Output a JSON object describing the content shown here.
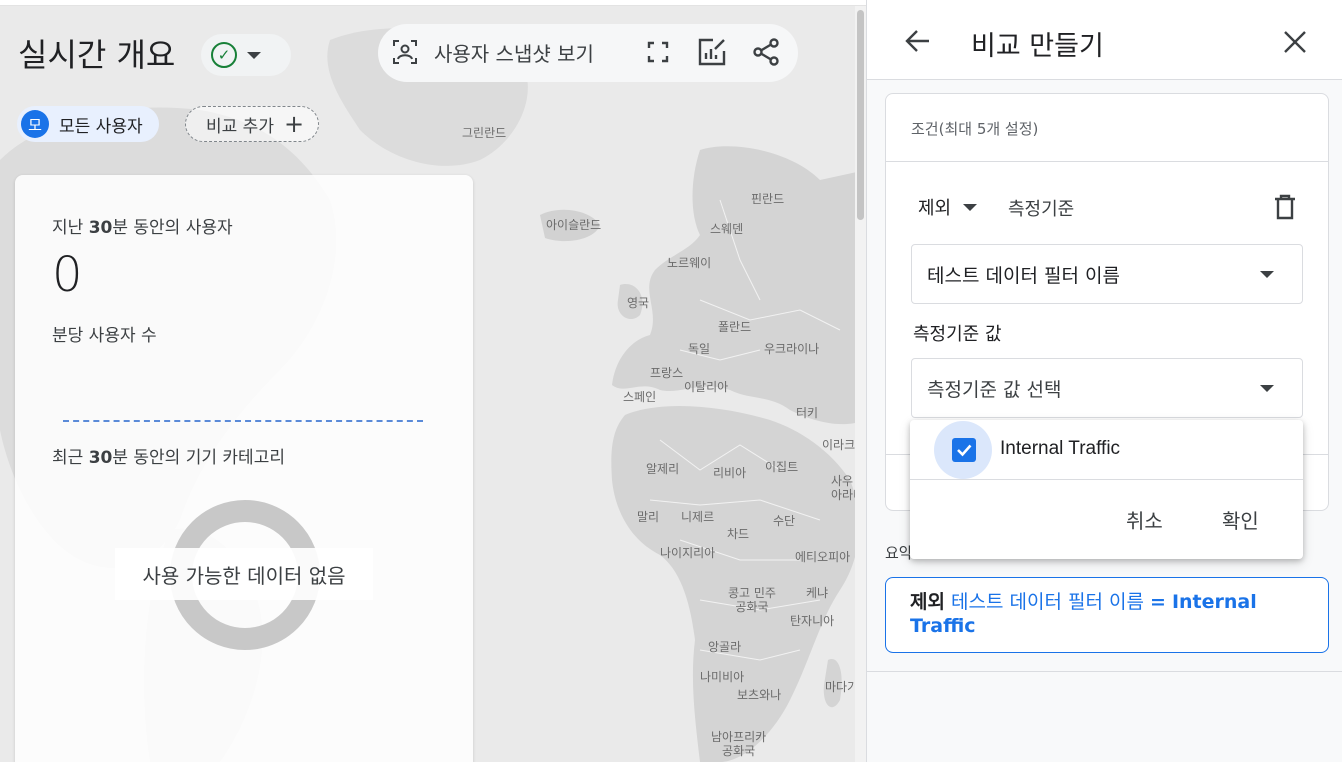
{
  "header": {
    "title": "실시간 개요",
    "status_icon": "check-circle-icon",
    "toolbar": {
      "snapshot_label": "사용자 스냅샷 보기",
      "icons": [
        "user-snapshot-icon",
        "fullscreen-icon",
        "customize-report-icon",
        "share-icon"
      ]
    }
  },
  "comparisons": {
    "all_users_avatar": "모",
    "all_users_label": "모든 사용자",
    "add_label": "비교 추가"
  },
  "map": {
    "labels": [
      "그린란드",
      "아이슬란드",
      "핀란드",
      "스웨덴",
      "노르웨이",
      "영국",
      "폴란드",
      "독일",
      "우크라이나",
      "프랑스",
      "이탈리아",
      "스페인",
      "터키",
      "이라크",
      "알제리",
      "리비아",
      "이집트",
      "사우디아라비아",
      "말리",
      "니제르",
      "차드",
      "수단",
      "나이지리아",
      "에티오피아",
      "콩고 민주 공화국",
      "케냐",
      "탄자니아",
      "앙골라",
      "나미비아",
      "보츠와나",
      "마다가스카르",
      "남아프리카 공화국"
    ]
  },
  "card": {
    "users_label_prefix": "지난 ",
    "users_label_bold": "30",
    "users_label_suffix": "분 동안의 사용자",
    "users_count": "0",
    "per_minute_label": "분당 사용자 수",
    "device_label_prefix": "최근 ",
    "device_label_bold": "30",
    "device_label_suffix": "분 동안의 기기 카테고리",
    "no_data": "사용 가능한 데이터 없음"
  },
  "panel": {
    "title": "비교 만들기",
    "conditions_title": "조건(최대 5개 설정)",
    "include_mode": "제외",
    "metric_label": "측정기준",
    "dimension_value": "테스트 데이터 필터 이름",
    "metric_value_label": "측정기준 값",
    "metric_value_placeholder": "측정기준 값 선택",
    "summary_label": "요약",
    "summary": {
      "mode": "제외",
      "dimension": "테스트 데이터 필터 이름",
      "operator": "=",
      "value": "Internal Traffic"
    },
    "popup": {
      "option_label": "Internal Traffic",
      "option_checked": true,
      "cancel_label": "취소",
      "confirm_label": "확인"
    }
  },
  "colors": {
    "accent": "#1a73e8",
    "success": "#188038",
    "map_land": "#d6d6d6",
    "map_sea": "#eaeaea"
  }
}
